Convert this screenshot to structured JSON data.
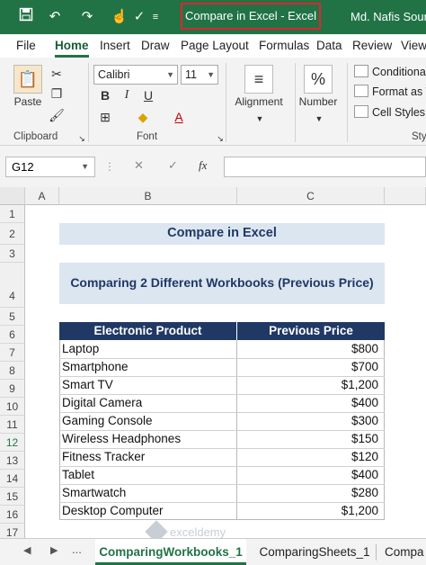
{
  "titlebar": {
    "title": "Compare in Excel  -  Excel",
    "user": "Md. Nafis Soum",
    "qat_icons": [
      "save-icon",
      "undo-icon",
      "redo-icon",
      "touch-mode-icon",
      "checkmark-icon",
      "customize-qat-icon"
    ]
  },
  "tabs": [
    "File",
    "Home",
    "Insert",
    "Draw",
    "Page Layout",
    "Formulas",
    "Data",
    "Review",
    "View"
  ],
  "active_tab": "Home",
  "ribbon": {
    "paste_label": "Paste",
    "clipboard_label": "Clipboard",
    "font_name": "Calibri",
    "font_size": "11",
    "font_label": "Font",
    "alignment_label": "Alignment",
    "number_label": "Number",
    "number_glyph": "%",
    "conditional": "Conditional",
    "format_as": "Format as T",
    "cell_styles": "Cell Styles",
    "styles_label": "Sty",
    "bold": "B",
    "italic": "I",
    "underline": "U",
    "font_color_glyph": "A",
    "highlight_glyph": "A"
  },
  "formula_bar": {
    "name_box": "G12",
    "cancel_glyph": "✕",
    "enter_glyph": "✓",
    "fx": "fx",
    "value": ""
  },
  "columns": [
    "A",
    "B",
    "C"
  ],
  "rows": [
    "1",
    "2",
    "3",
    "4",
    "5",
    "6",
    "7",
    "8",
    "9",
    "10",
    "11",
    "12",
    "13",
    "14",
    "15",
    "16",
    "17"
  ],
  "selected_row": "12",
  "sheet": {
    "title": "Compare in Excel",
    "subtitle": "Comparing 2 Different Workbooks (Previous Price)",
    "headers": [
      "Electronic Product",
      "Previous Price"
    ],
    "products": [
      {
        "name": "Laptop",
        "price": "$800"
      },
      {
        "name": "Smartphone",
        "price": "$700"
      },
      {
        "name": "Smart TV",
        "price": "$1,200"
      },
      {
        "name": "Digital Camera",
        "price": "$400"
      },
      {
        "name": "Gaming Console",
        "price": "$300"
      },
      {
        "name": "Wireless Headphones",
        "price": "$150"
      },
      {
        "name": "Fitness Tracker",
        "price": "$120"
      },
      {
        "name": "Tablet",
        "price": "$400"
      },
      {
        "name": "Smartwatch",
        "price": "$280"
      },
      {
        "name": "Desktop Computer",
        "price": "$1,200"
      }
    ]
  },
  "sheet_tabs": {
    "prev": "◀",
    "next": "▶",
    "more": "...",
    "items": [
      "ComparingWorkbooks_1",
      "ComparingSheets_1",
      "Compa"
    ],
    "active": "ComparingWorkbooks_1"
  },
  "watermark": "exceldemy",
  "colors": {
    "excel_green": "#217346",
    "title_fill": "#dce6f1",
    "header_fill": "#203864",
    "highlight_red": "#e0242f"
  }
}
